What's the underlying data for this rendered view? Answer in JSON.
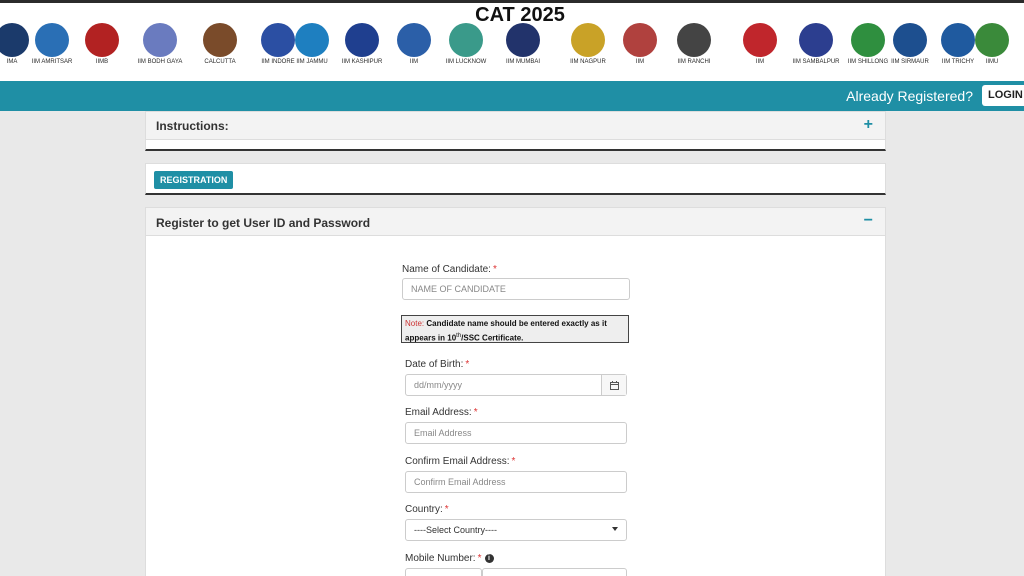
{
  "header": {
    "title": "CAT 2025",
    "logos": [
      {
        "caption": "IMA",
        "color": "#1b3a6b"
      },
      {
        "caption": "IIM AMRITSAR",
        "color": "#2a6fb5"
      },
      {
        "caption": "IIMB",
        "color": "#b22222"
      },
      {
        "caption": "IIM BODH GAYA",
        "color": "#6a7bbf"
      },
      {
        "caption": "CALCUTTA",
        "color": "#7a4b2a"
      },
      {
        "caption": "IIM INDORE",
        "color": "#2b4fa3"
      },
      {
        "caption": "IIM JAMMU",
        "color": "#1e7fc0"
      },
      {
        "caption": "IIM KASHIPUR",
        "color": "#1f3f8f"
      },
      {
        "caption": "IIM",
        "color": "#2b5fa8"
      },
      {
        "caption": "IIM LUCKNOW",
        "color": "#3a9a8a"
      },
      {
        "caption": "IIM MUMBAI",
        "color": "#22336b"
      },
      {
        "caption": "IIM NAGPUR",
        "color": "#c9a227"
      },
      {
        "caption": "IIM",
        "color": "#b0413e"
      },
      {
        "caption": "IIM RANCHI",
        "color": "#444444"
      },
      {
        "caption": "IIM",
        "color": "#c0262c"
      },
      {
        "caption": "IIM SAMBALPUR",
        "color": "#2c3e8f"
      },
      {
        "caption": "IIM SHILLONG",
        "color": "#2f8f3f"
      },
      {
        "caption": "IIM SIRMAUR",
        "color": "#1d4f8f"
      },
      {
        "caption": "IIM TRICHY",
        "color": "#1f5a9f"
      },
      {
        "caption": "IIMU",
        "color": "#3a8a3a"
      }
    ]
  },
  "nav": {
    "already_registered": "Already Registered?",
    "login_label": "LOGIN H"
  },
  "instructions": {
    "title": "Instructions:",
    "toggle": "+"
  },
  "registration_tab": {
    "label": "REGISTRATION"
  },
  "register_panel": {
    "title": "Register to get User ID and Password",
    "toggle": "−",
    "fields": {
      "name_label": "Name of Candidate:",
      "name_placeholder": "NAME OF CANDIDATE",
      "note_prefix": "Note:",
      "note_text_a": "Candidate name should be entered exactly as it appears in 10",
      "note_sup": "th",
      "note_text_b": "/SSC Certificate.",
      "dob_label": "Date of Birth:",
      "dob_placeholder": "dd/mm/yyyy",
      "email_label": "Email Address:",
      "email_placeholder": "Email Address",
      "confirm_email_label": "Confirm Email Address:",
      "confirm_email_placeholder": "Confirm Email Address",
      "country_label": "Country:",
      "country_value": "----Select Country----",
      "mobile_label": "Mobile Number:",
      "required_marker": "*",
      "info_glyph": "i"
    }
  }
}
